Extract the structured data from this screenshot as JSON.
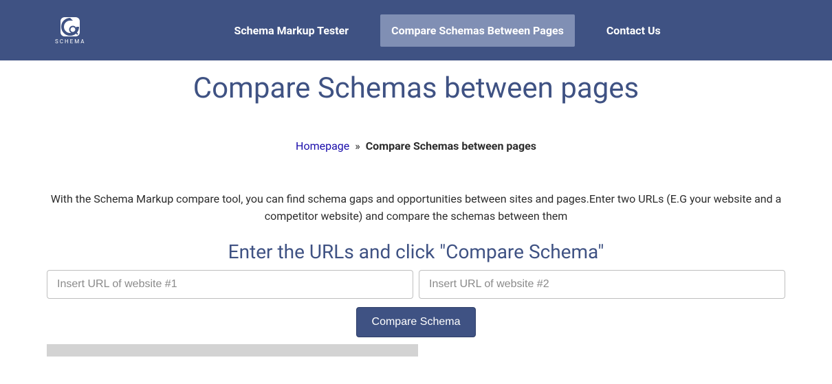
{
  "brand": {
    "name": "SCHEMA"
  },
  "nav": {
    "items": [
      {
        "label": "Schema Markup Tester",
        "active": false
      },
      {
        "label": "Compare Schemas Between Pages",
        "active": true
      },
      {
        "label": "Contact Us",
        "active": false
      }
    ]
  },
  "page": {
    "title": "Compare Schemas between pages"
  },
  "breadcrumb": {
    "home_label": "Homepage",
    "separator": "»",
    "current": "Compare Schemas between pages"
  },
  "description": "With the Schema Markup compare tool, you can find schema gaps and opportunities between sites and pages.Enter two URLs (E.G your website and a competitor website) and compare the schemas between them",
  "form": {
    "heading": "Enter the URLs and click \"Compare Schema\"",
    "url1_placeholder": "Insert URL of website #1",
    "url2_placeholder": "Insert URL of website #2",
    "submit_label": "Compare Schema"
  },
  "colors": {
    "brand": "#3f5283",
    "nav_active_bg": "#808fb4",
    "link": "#1a0dab",
    "placeholder_strip": "#d3d3d3"
  }
}
